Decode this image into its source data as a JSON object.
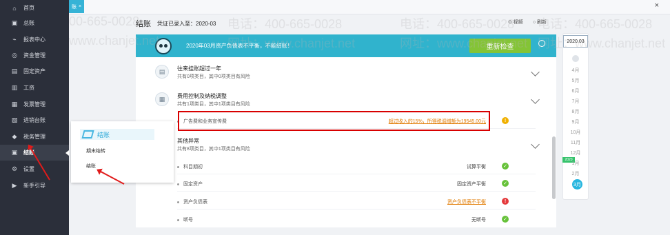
{
  "sidebar": {
    "items": [
      {
        "label": "首页",
        "icon": "home-icon",
        "glyph": "⌂"
      },
      {
        "label": "总账",
        "icon": "ledger-icon",
        "glyph": "▣"
      },
      {
        "label": "报表中心",
        "icon": "chart-icon",
        "glyph": "⌁"
      },
      {
        "label": "资金管理",
        "icon": "money-icon",
        "glyph": "◎"
      },
      {
        "label": "固定资产",
        "icon": "asset-icon",
        "glyph": "▤"
      },
      {
        "label": "工资",
        "icon": "salary-icon",
        "glyph": "▥"
      },
      {
        "label": "发票管理",
        "icon": "invoice-icon",
        "glyph": "▦"
      },
      {
        "label": "进销台账",
        "icon": "inventory-icon",
        "glyph": "▧"
      },
      {
        "label": "税务管理",
        "icon": "tax-icon",
        "glyph": "◆"
      },
      {
        "label": "结账",
        "icon": "closing-icon",
        "glyph": "▣",
        "active": true
      },
      {
        "label": "设置",
        "icon": "settings-icon",
        "glyph": "⚙"
      },
      {
        "label": "新手引导",
        "icon": "guide-icon",
        "glyph": "▶"
      }
    ]
  },
  "tab": {
    "label": "账",
    "close": "×"
  },
  "window": {
    "close": "×"
  },
  "header": {
    "title": "结账",
    "voucher_status": "凭证已录入至：2020-03"
  },
  "actions": {
    "video": "⊙ 视频",
    "refresh": "○ 刷新"
  },
  "banner": {
    "text": "2020年03月资产负债表不平衡，不能结账！",
    "button": "重新检查"
  },
  "groups": [
    {
      "title": "往来挂账超过一年",
      "subtitle": "共有0项类目，其中0项类目有风险",
      "icon": "document-icon",
      "glyph": "▤"
    },
    {
      "title": "费用控制及纳税调整",
      "subtitle": "共有1项类目，其中1项类目有风险",
      "icon": "tax-adjust-icon",
      "glyph": "▦"
    },
    {
      "title": "其他异常",
      "subtitle": "共有8项类目，其中1项类目有风险"
    }
  ],
  "rows": [
    {
      "label": "广告费和业务宣传费",
      "value": "超过收入的15%，所得税调增额为19545.00元",
      "status": "!",
      "status_type": "warn"
    },
    {
      "label": "科目期初",
      "value": "试算平衡",
      "status": "✓",
      "status_type": "ok"
    },
    {
      "label": "固定资产",
      "value": "固定资产平衡",
      "status": "✓",
      "status_type": "ok"
    },
    {
      "label": "资产负债表",
      "value": "资产负债表不平衡",
      "status": "!",
      "status_type": "err"
    },
    {
      "label": "断号",
      "value": "无断号",
      "status": "✓",
      "status_type": "ok"
    }
  ],
  "months": {
    "year": "2020.03",
    "badge": "2020",
    "list": [
      "4月",
      "5月",
      "6月",
      "7月",
      "8月",
      "9月",
      "10月",
      "11月",
      "12月",
      "1月",
      "2月"
    ],
    "current": "3月"
  },
  "popup": {
    "title": "结账",
    "items": [
      "期末结转",
      "结账"
    ]
  },
  "watermarks": [
    "00-665-0028",
    "电话：400-665-0028",
    "电话：400-665-0028",
    "电话：400-665-0028",
    "www.chanjet.net",
    "网址：www.chanjet.net",
    "网址：www.chanjet.net",
    "网址：www.chanjet.net"
  ]
}
